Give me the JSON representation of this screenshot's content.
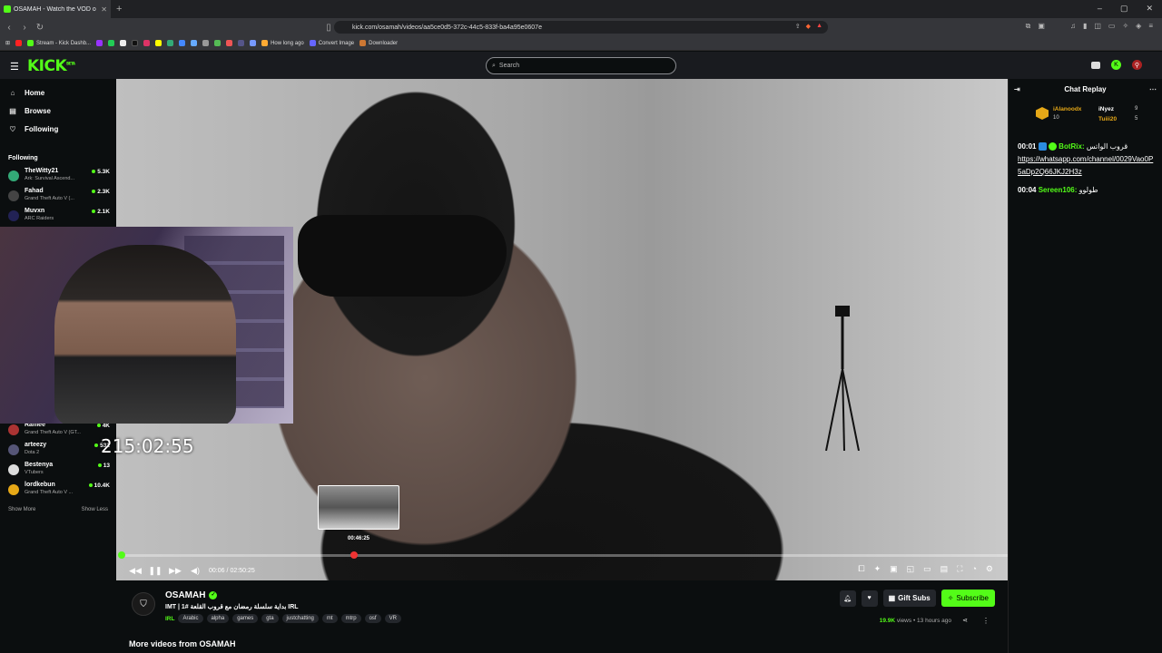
{
  "browser": {
    "tab_title": "OSAMAH - Watch the VOD o",
    "url": "kick.com/osamah/videos/aa5ce0d5-372c-44c5-833f-ba4a95e0607e",
    "window_controls": [
      "–",
      "▢",
      "✕"
    ],
    "bookmarks": [
      "Stream - Kick Dashb...",
      "How long ago",
      "Convert Image",
      "Downloader"
    ]
  },
  "header": {
    "logo": "KICK",
    "logo_sup": "BETA",
    "search_placeholder": "Search"
  },
  "sidebar": {
    "nav": [
      {
        "label": "Home",
        "icon": "home-icon"
      },
      {
        "label": "Browse",
        "icon": "compass-icon"
      },
      {
        "label": "Following",
        "icon": "heart-icon"
      }
    ],
    "following_heading": "Following",
    "following": [
      {
        "name": "TheWitty21",
        "game": "Ark: Survival Ascend...",
        "viewers": "5.3K",
        "color": "#3a7"
      },
      {
        "name": "Fahad",
        "game": "Grand Theft Auto V (...",
        "viewers": "2.3K",
        "color": "#444"
      },
      {
        "name": "Muvxn",
        "game": "ARC Raiders",
        "viewers": "2.1K",
        "color": "#225"
      },
      {
        "name": "Ramee",
        "game": "Grand Theft Auto V (GT...",
        "viewers": "4K",
        "color": "#a33"
      },
      {
        "name": "arteezy",
        "game": "Dota 2",
        "viewers": "532",
        "color": "#557"
      },
      {
        "name": "Bestenya",
        "game": "VTubers",
        "viewers": "13",
        "color": "#ddd"
      },
      {
        "name": "lordkebun",
        "game": "Grand Theft Auto V ...",
        "viewers": "10.4K",
        "color": "#e6a817"
      }
    ],
    "show_more": "Show More",
    "show_less": "Show Less"
  },
  "video": {
    "overlay_timer": "215:02:55",
    "preview_time": "00:46:25",
    "current_time": "00:06",
    "duration": "02:50:25",
    "progress_fraction": 0.002,
    "hover_fraction": 0.264
  },
  "chat": {
    "title": "Chat Replay",
    "gifters": [
      {
        "name": "iAlanoodx",
        "count": "10"
      },
      {
        "name": "iNyez",
        "count": "9"
      },
      {
        "name": "Tuiii20",
        "count": "5"
      }
    ],
    "messages": [
      {
        "time": "00:01",
        "user": "BotRix:",
        "text": "قروب الواتس",
        "link": "https://whatsapp.com/channel/0029Vao0P5aDp2Q66JKJ2H3z"
      },
      {
        "time": "00:04",
        "user": "Sereen106:",
        "text": "طولوو"
      }
    ]
  },
  "info": {
    "channel": "OSAMAH",
    "title": "IMT | 1# بداية سلسلة رمضان مع قروب القلعة IRL",
    "category": "IRL",
    "tags": [
      "Arabic",
      "alpha",
      "games",
      "gta",
      "justchatting",
      "mt",
      "mtrp",
      "osf",
      "VR"
    ],
    "gift_label": "Gift Subs",
    "subscribe_label": "Subscribe",
    "views": "19.9K",
    "views_word": "views",
    "ago": "13 hours ago",
    "more_videos": "More videos from OSAMAH"
  }
}
